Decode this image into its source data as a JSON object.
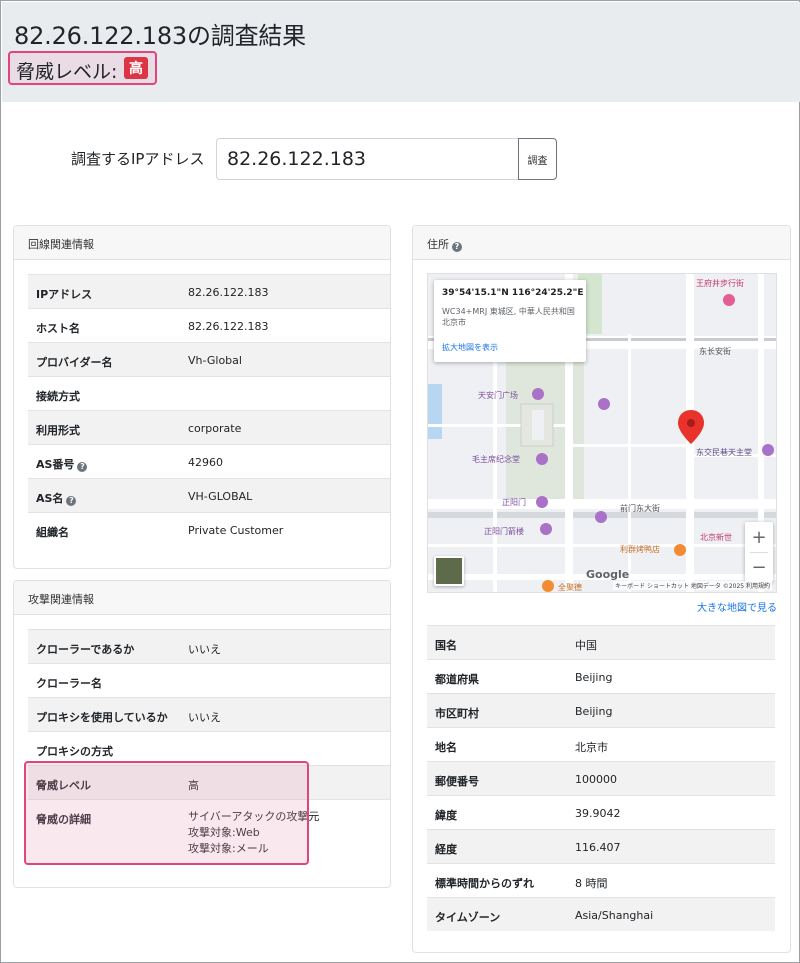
{
  "page": {
    "title": "82.26.122.183の調査結果",
    "threat_label": "脅威レベル:",
    "threat_badge": "高"
  },
  "search": {
    "label": "調査するIPアドレス",
    "value": "82.26.122.183",
    "button": "調査"
  },
  "line_info": {
    "title": "回線関連情報",
    "rows": [
      {
        "key": "IPアドレス",
        "value": "82.26.122.183"
      },
      {
        "key": "ホスト名",
        "value": "82.26.122.183"
      },
      {
        "key": "プロバイダー名",
        "value": "Vh-Global"
      },
      {
        "key": "接続方式",
        "value": ""
      },
      {
        "key": "利用形式",
        "value": "corporate"
      },
      {
        "key": "AS番号",
        "value": "42960"
      },
      {
        "key": "AS名",
        "value": "VH-GLOBAL"
      },
      {
        "key": "組織名",
        "value": "Private Customer"
      }
    ]
  },
  "attack_info": {
    "title": "攻撃関連情報",
    "rows": [
      {
        "key": "クローラーであるか",
        "value": "いいえ"
      },
      {
        "key": "クローラー名",
        "value": ""
      },
      {
        "key": "プロキシを使用しているか",
        "value": "いいえ"
      },
      {
        "key": "プロキシの方式",
        "value": ""
      },
      {
        "key": "脅威レベル",
        "value": "高"
      },
      {
        "key": "脅威の詳細",
        "lines": [
          "サイバーアタックの攻撃元",
          "攻撃対象:Web",
          "攻撃対象:メール"
        ]
      }
    ]
  },
  "address": {
    "title": "住所",
    "map": {
      "coord": "39°54'15.1\"N 116°24'25.2\"E",
      "addr": "WC34+MRJ 東城区, 中華人民共和国北京市",
      "link": "拡大地図を表示",
      "logo": "Google",
      "footer": "キーボード ショートカット  地図データ ©2025  利用規約",
      "labels": {
        "tiananmen": "天安门广场",
        "mao": "毛主席纪念堂",
        "zhengyang": "正阳门",
        "zhengyang_arrow": "正阳门箭楼",
        "east_church": "东交民巷天主堂",
        "wangfujing": "王府井步行街",
        "east_chang": "东长安街",
        "qianmen_east": "前门东大街",
        "roast_duck": "利群烤鸭店",
        "beijing_new": "北京新世",
        "quanjude": "全聚德"
      }
    },
    "bigmap_link": "大きな地図で見る",
    "rows": [
      {
        "key": "国名",
        "value": "中国"
      },
      {
        "key": "都道府県",
        "value": "Beijing"
      },
      {
        "key": "市区町村",
        "value": "Beijing"
      },
      {
        "key": "地名",
        "value": "北京市"
      },
      {
        "key": "郵便番号",
        "value": "100000"
      },
      {
        "key": "緯度",
        "value": "39.9042"
      },
      {
        "key": "経度",
        "value": "116.407"
      },
      {
        "key": "標準時間からのずれ",
        "value": "8 時間"
      },
      {
        "key": "タイムゾーン",
        "value": "Asia/Shanghai"
      }
    ]
  }
}
